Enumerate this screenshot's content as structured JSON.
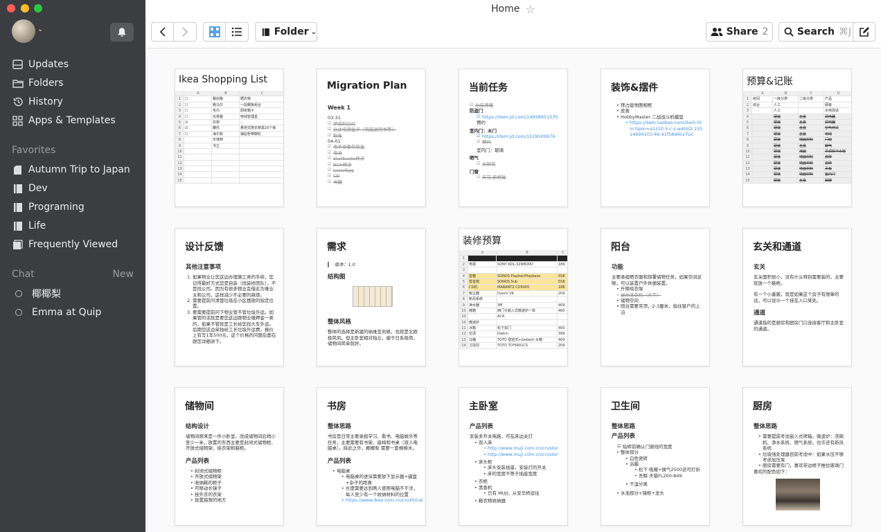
{
  "window": {
    "title": "Home"
  },
  "sidebar": {
    "nav": [
      {
        "label": "Updates",
        "icon": "updates-icon"
      },
      {
        "label": "Folders",
        "icon": "folders-icon"
      },
      {
        "label": "History",
        "icon": "history-icon"
      },
      {
        "label": "Apps & Templates",
        "icon": "apps-icon"
      }
    ],
    "favorites_header": "Favorites",
    "favorites": [
      "Autumn Trip to Japan",
      "Dev",
      "Programing",
      "Life",
      "Frequently Viewed"
    ],
    "chat_header": "Chat",
    "chat_new": "New",
    "chats": [
      "椰椰梨",
      "Emma at Quip"
    ]
  },
  "toolbar": {
    "folder_label": "Folder",
    "share_label": "Share",
    "share_count": "2",
    "search_label": "Search",
    "search_shortcut": "⌘J"
  },
  "cards": [
    {
      "title": "Ikea Shopping List",
      "type": "sheet"
    },
    {
      "title": "Migration Plan",
      "sub": "Week 1",
      "lines": [
        "03-31",
        "伊诺利台灯",
        "台达电源盒子（电脑说明书等）",
        "取车",
        "04-01",
        "电子设备包装盒",
        "电池",
        "Starbucks杯子",
        "BCH杯子",
        "LaserEgg",
        "CD",
        "书籍"
      ]
    },
    {
      "title": "当前任务",
      "lines": [
        "垃圾清理",
        "防盗门",
        "https://item.jd.com/14938951535",
        "预约",
        "室内门：木门",
        "https://item.jd.com/1129509976",
        "预约",
        "室内门：玻璃",
        "晒气",
        "太阳花",
        "门窗",
        "天花·新桥轴"
      ]
    },
    {
      "title": "装饰&摆件",
      "lines": [
        "拜占庭地图相框",
        "皮善",
        "HobbyMaster 二战战斗机模型",
        "https://item.taobao.com/item.htm?spm=a1z10.5-c-s.w4002-15514694103.46.41f58d4cx7Uc"
      ]
    },
    {
      "title": "预算&记账",
      "type": "sheet"
    },
    {
      "title": "设计反馈",
      "sub": "其他注意事项",
      "lines": [
        "如果物业让您这边办理施工类的手续，您记得最好方式您是自装（找装修团队），不是找公司。因为有很多物业会借此为难业主和公司，这样减少不必要的麻烦。",
        "需要提前问清楚垃圾在小区摆放的指定位置。",
        "要需要提前问下物业管不管垃圾外运。如果管的话就是要您这边跟物业缴押金一类的，如果不管就是工长给您找大车外运。后期您这边单独给工长垃圾外运费。报价上有写1车500元，这个价格的问题后面在跟您详细讲下。"
      ]
    },
    {
      "title": "需求",
      "lines": [
        "版本：1.0",
        "结构图",
        "整体风格",
        "整体的选择是新建的纳维亚风格，也就是北欧极简风。但主卧室相对独立，偏于日系极简，储物间简单就好。"
      ]
    },
    {
      "title": "装修预算",
      "type": "sheet"
    },
    {
      "title": "阳台",
      "sub": "功能",
      "lines": [
        "主要承担晒衣服和部署储物任务，如果空间足够，可以装置户外休憩装置。",
        "升降晾衣架",
        "迷你洗衣机（大字）",
        "储物空间",
        "阳台需要吊顶，2-3厘米，指住窗户的上沿"
      ]
    },
    {
      "title": "玄关和通道",
      "sub": "玄关",
      "lines": [
        "玄关面积很小，没有什么特别需要装的，主要就放一个鞋柜。",
        "有一个小墨菌，就是如果这个房子有德章的话，可以设计一个挂在入口某处。",
        "通道",
        "通道指的是厨房和厨房门口连接客厅和主卧室的通道。"
      ]
    },
    {
      "title": "储物间",
      "sub": "结构设计",
      "lines": [
        "储物间原来是一件小卧室，改成储物间后稍小至少一米，放置的东西主要是封闭式储物柜、开放式储物架、挂衣架和鞋柜。",
        "产品列表",
        "封闭式储物柜",
        "开放式储物架",
        "收纳鞋的柜子",
        "可移动长镜子",
        "挂外衣的衣架",
        "放置猫窝的地方"
      ]
    },
    {
      "title": "书房",
      "sub": "整体思路",
      "lines": [
        "书房是日常主要承担学习、看书、电脑娱乐等任务，主要需要有书架、座椅和书桌（双人电脑桌）。除此之外，椰椰梨 需要一套棉棉木。",
        "产品列表",
        "电脑桌",
        "电脑桌的进深需要放下显示器+键盘+杂子的距离",
        "长度需要达到两人使用电脑不干涉，每人至少有一个收纳材料的位置",
        "https://www.ikea.com.cn/cn/zh/cat"
      ]
    },
    {
      "title": "主卧室",
      "sub": "产品列表",
      "lines": [
        "安装多开关电路，可在床边关灯",
        "双人床",
        "http://www.muji.com.cn/cn/stor",
        "http://www.muji.com.cn/cn/stor",
        "床头柜",
        "床头安装插座，安装灯的开关",
        "床的宽度不等于插座宽度",
        "衣柜",
        "黑香机",
        "已有 MUJI，从安华桥运往",
        "鞋衣物收纳器"
      ]
    },
    {
      "title": "卫生间",
      "sub": "整体思路",
      "lines": [
        "产品列表",
        "贴砖前确认门窗线的宽度",
        "整体部分",
        "白色瓷砖",
        "浴霸",
        "松下·吸暖+换气2500还可打折",
        "吾鲸·天猫FL200-849",
        "干湿分离",
        "水池部分+镜柜+龙头"
      ]
    },
    {
      "title": "厨房",
      "sub": "整体思路",
      "lines": [
        "需要提前考虑嵌入式烤箱，微波炉：洗碗机、净水系统、燃气系统。也许还有新风系统",
        "垃圾强处理器目前考虑中：如果水压不够考虑加压泵",
        "厨房需要有门，喜欢带边框子推拉玻璃门",
        "喜欢的配色如下："
      ]
    }
  ],
  "sheets": {
    "ikea": {
      "cols": [
        "",
        "A",
        "B",
        "C"
      ],
      "rows": [
        [
          "1",
          "☐",
          "餐刹格",
          "晒衣架"
        ],
        [
          "2",
          "☐",
          "奥马尔",
          "一段鋼板组合"
        ],
        [
          "3",
          "☐",
          "毛巾",
          "厨房箱子"
        ],
        [
          "4",
          "☐",
          "充排塞",
          "电线管理盒"
        ],
        [
          "5",
          "☑",
          "衣架",
          "-"
        ],
        [
          "6",
          "☑",
          "罐托",
          "悬挂式搭衣架黑16个装"
        ],
        [
          "7",
          "☐",
          "海尔默",
          "抽屉柜带脚轮"
        ],
        [
          "8",
          "",
          "叉墙特",
          ""
        ],
        [
          "9",
          "",
          "书立",
          ""
        ],
        [
          "10",
          "",
          "",
          ""
        ],
        [
          "11",
          "",
          "",
          ""
        ],
        [
          "12",
          "",
          "",
          ""
        ],
        [
          "13",
          "",
          "",
          ""
        ],
        [
          "14",
          "",
          "",
          ""
        ],
        [
          "15",
          "",
          "",
          ""
        ]
      ]
    },
    "budget": {
      "cols": [
        "",
        "A",
        "B",
        "C",
        "D"
      ],
      "rows": [
        [
          "1",
          "房间",
          "一级分类",
          "二级分类",
          "产品"
        ],
        [
          "2",
          "综合",
          "人工",
          "",
          "硬装"
        ],
        [
          "3",
          "",
          "人工",
          "",
          "水电改造"
        ],
        [
          "4",
          "",
          "硬装",
          "五金",
          "洞电器"
        ],
        [
          "5",
          "",
          "硬装",
          "五金",
          "洞电器"
        ],
        [
          "6",
          "",
          "硬装",
          "五金",
          "空气开关"
        ],
        [
          "7",
          "",
          "硬装",
          "五金",
          "电线"
        ],
        [
          "8",
          "",
          "硬装",
          "墙面材料",
          "门窗"
        ],
        [
          "9",
          "",
          "硬装",
          "五金",
          "暖气"
        ],
        [
          "10",
          "",
          "硬装",
          "洗面",
          "吊顶和下水管"
        ],
        [
          "11",
          "",
          "硬装",
          "墙面材料",
          "瓷砖"
        ],
        [
          "12",
          "",
          "硬装",
          "墙面材料",
          "瓷砖"
        ],
        [
          "13",
          "",
          "硬装",
          "墙面材料",
          "吊板"
        ],
        [
          "14",
          "",
          "硬装",
          "墙面材料",
          "室内门"
        ],
        [
          "15",
          "",
          "硬装",
          "五金",
          "踢脚"
        ]
      ]
    },
    "reno": {
      "cols": [
        "",
        "A",
        "B",
        "C"
      ],
      "rows": [
        [
          "1",
          "",
          "",
          ""
        ],
        [
          "2",
          "电视",
          "SONY KDL-32W600D",
          "189"
        ],
        [
          "3",
          "",
          "",
          ""
        ],
        [
          "4",
          "音箱",
          "SONOS Playbar/Playbase",
          "558"
        ],
        [
          "5",
          "低音炮",
          "SONOS Sub",
          "558"
        ],
        [
          "6",
          "CD机",
          "MARANTZ CD5005",
          "188"
        ],
        [
          "7",
          "吸尘器",
          "Dyson V6",
          "209"
        ],
        [
          "8",
          "新风系统",
          "",
          ""
        ],
        [
          "9",
          "净水器",
          "3M",
          "409"
        ],
        [
          "10",
          "烤箱",
          "西门子嵌入式微波炉一体",
          "460"
        ],
        [
          "10",
          "",
          "ACA",
          ""
        ],
        [
          "10",
          "微波炉",
          "",
          ""
        ],
        [
          "11",
          "冰箱",
          "松下双门",
          "400"
        ],
        [
          "12",
          "空调",
          "Daikin",
          "399"
        ],
        [
          "13",
          "马桶",
          "TOTO 壁挂式+Geberit 水箱",
          "409"
        ],
        [
          "14",
          "卫浴间",
          "TOTO TCF6401CS",
          "209"
        ]
      ]
    }
  }
}
